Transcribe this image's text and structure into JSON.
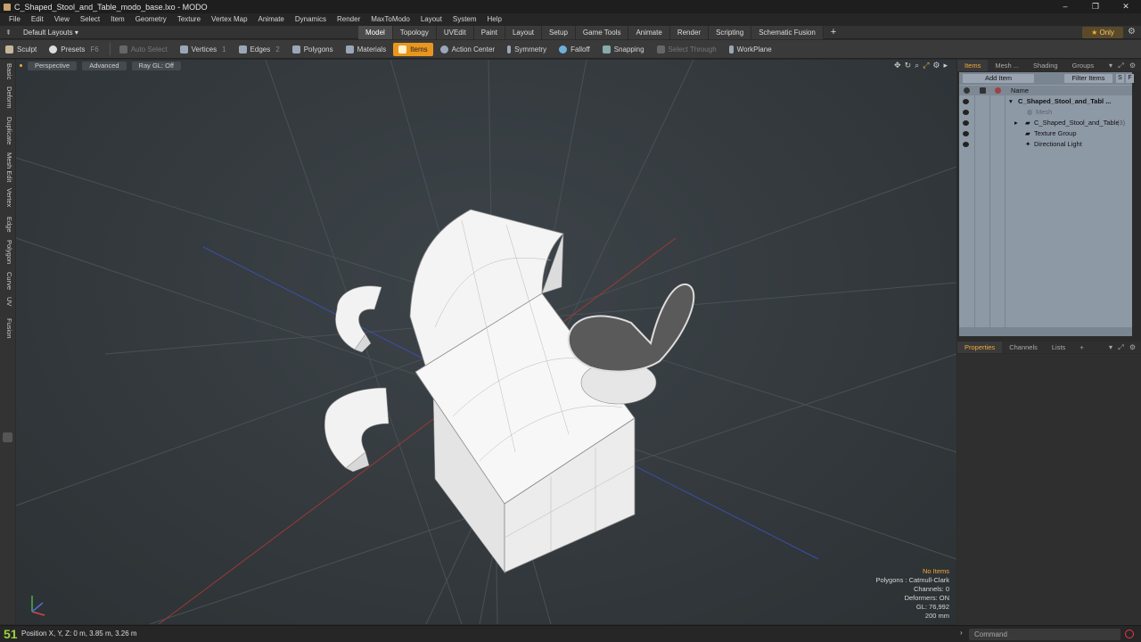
{
  "window": {
    "title": "C_Shaped_Stool_and_Table_modo_base.lxo - MODO",
    "controls": [
      "–",
      "❐",
      "✕"
    ]
  },
  "menu": [
    "File",
    "Edit",
    "View",
    "Select",
    "Item",
    "Geometry",
    "Texture",
    "Vertex Map",
    "Animate",
    "Dynamics",
    "Render",
    "MaxToModo",
    "Layout",
    "System",
    "Help"
  ],
  "layout_selector": "Default Layouts ▾",
  "layout_tabs": [
    "Model",
    "Topology",
    "UVEdit",
    "Paint",
    "Layout",
    "Setup",
    "Game Tools",
    "Animate",
    "Render",
    "Scripting",
    "Schematic Fusion"
  ],
  "active_layout_tab": "Model",
  "only_label": "Only",
  "toolbar": {
    "sculpt": "Sculpt",
    "presets": "Presets",
    "presets_key": "F6",
    "auto_select": "Auto Select",
    "vertices": "Vertices",
    "vertices_key": "1",
    "edges": "Edges",
    "edges_key": "2",
    "polygons": "Polygons",
    "materials": "Materials",
    "items": "Items",
    "action_center": "Action Center",
    "symmetry": "Symmetry",
    "falloff": "Falloff",
    "snapping": "Snapping",
    "select_through": "Select Through",
    "workplane": "WorkPlane"
  },
  "left_tabs": [
    "Basic",
    "Deform",
    "Duplicate",
    "Mesh Edit",
    "Vertex",
    "Edge",
    "Polygon",
    "Curve",
    "UV",
    "Fusion"
  ],
  "viewport": {
    "view": "Perspective",
    "shading": "Advanced",
    "raygl": "Ray GL: Off",
    "stats": {
      "selection": "No Items",
      "polygons": "Polygons : Catmull-Clark",
      "channels": "Channels: 0",
      "deformers": "Deformers: ON",
      "gl": "GL: 76,992",
      "scale": "200 mm"
    }
  },
  "status": {
    "fps": "51",
    "position": "Position X, Y, Z:   0 m, 3.85 m, 3.26 m",
    "command_placeholder": "Command"
  },
  "items_panel": {
    "tabs": [
      "Items",
      "Mesh ...",
      "Shading",
      "Groups"
    ],
    "add_item": "Add Item",
    "filter_items": "Filter Items",
    "s": "S",
    "f": "F",
    "column_name": "Name",
    "rows": [
      {
        "label": "C_Shaped_Stool_and_Tabl ...",
        "style": "bold"
      },
      {
        "label": "Mesh",
        "style": "dim"
      },
      {
        "label": "C_Shaped_Stool_and_Table",
        "sub": "(3)",
        "style": "normal"
      },
      {
        "label": "Texture Group",
        "style": "normal"
      },
      {
        "label": "Directional Light",
        "style": "normal"
      }
    ]
  },
  "properties_panel": {
    "tabs": [
      "Properties",
      "Channels",
      "Lists"
    ]
  }
}
